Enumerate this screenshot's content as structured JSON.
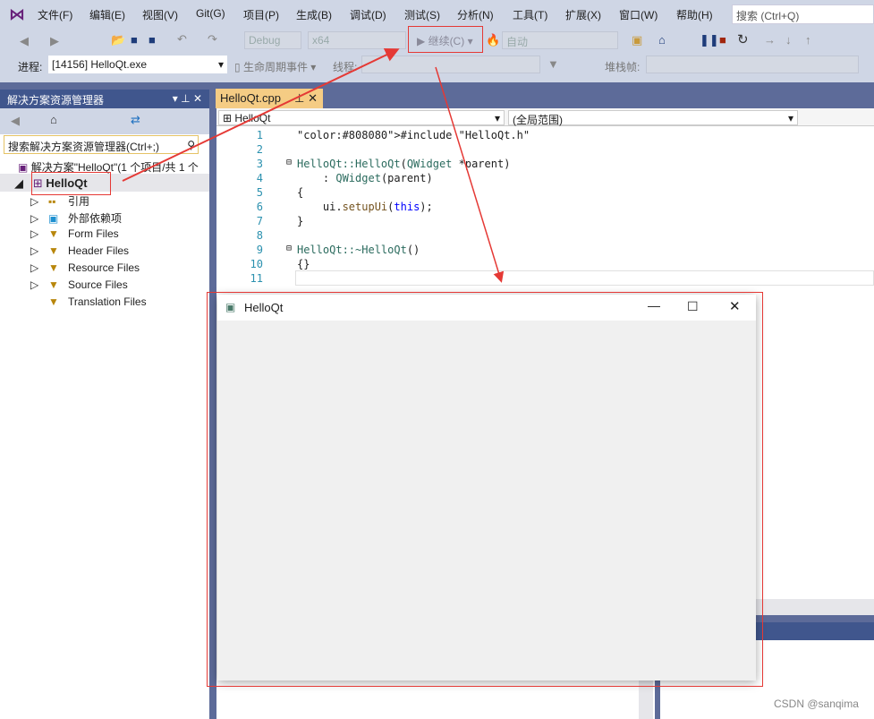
{
  "menu": [
    "文件(F)",
    "编辑(E)",
    "视图(V)",
    "Git(G)",
    "项目(P)",
    "生成(B)",
    "调试(D)",
    "测试(S)",
    "分析(N)",
    "工具(T)",
    "扩展(X)",
    "窗口(W)",
    "帮助(H)"
  ],
  "search_placeholder": "搜索 (Ctrl+Q)",
  "toolbar": {
    "config": "Debug",
    "platform": "x64",
    "continue": "继续(C)",
    "auto": "自动"
  },
  "debugbar": {
    "process_label": "进程:",
    "process": "[14156] HelloQt.exe",
    "lifecycle": "生命周期事件",
    "thread_label": "线程:",
    "stack_label": "堆栈帧:"
  },
  "solution_explorer": {
    "title": "解决方案资源管理器",
    "search": "搜索解决方案资源管理器(Ctrl+;)",
    "solution": "解决方案\"HelloQt\"(1 个项目/共 1 个",
    "project": "HelloQt",
    "items": [
      "引用",
      "外部依赖项",
      "Form Files",
      "Header Files",
      "Resource Files",
      "Source Files",
      "Translation Files"
    ]
  },
  "editor": {
    "tab": "HelloQt.cpp",
    "scope_left": "HelloQt",
    "scope_right": "(全局范围)",
    "lines": [
      "#include \"HelloQt.h\"",
      "",
      "HelloQt::HelloQt(QWidget *parent)",
      "    : QWidget(parent)",
      "{",
      "    ui.setupUi(this);",
      "}",
      "",
      "HelloQt::~HelloQt()",
      "{}",
      ""
    ]
  },
  "qt_window": {
    "title": "HelloQt"
  },
  "watermark": "CSDN @sanqima",
  "colors": {
    "accent": "#40568d",
    "tab": "#f5cc84",
    "annotation": "#e53935"
  }
}
